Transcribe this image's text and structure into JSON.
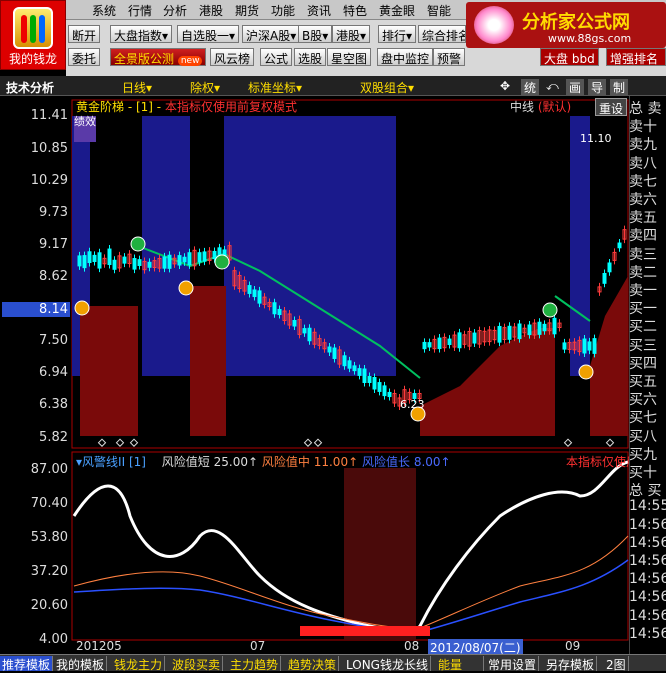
{
  "menu": [
    "系统",
    "行情",
    "分析",
    "港股",
    "期货",
    "功能",
    "资讯",
    "特色",
    "黄金眼",
    "智能"
  ],
  "logo_label": "我的钱龙",
  "toolbar_row1": [
    "断开",
    "大盘指数",
    "自选股一",
    "沪深A股",
    "B股",
    "港股",
    "排行",
    "综合排名"
  ],
  "toolbar_row2": [
    "委托",
    "全景版公测",
    "风云榜",
    "公式",
    "选股",
    "星空图",
    "盘中监控",
    "预警"
  ],
  "toolbar_row2_badge": "new",
  "watermark": {
    "title": "分析家公式网",
    "url": "www.88gs.com"
  },
  "right_tabs": [
    "大盘",
    "bbd",
    "增强排名"
  ],
  "bar2": {
    "section": "技术分析",
    "period": "日线",
    "adjust": "除权",
    "coord": "标准坐标",
    "dual": "双股组合",
    "icons": [
      "统",
      "画",
      "导",
      "制"
    ]
  },
  "main_panel": {
    "title": "黄金阶梯",
    "param": "[1]",
    "note": "本指标仅使用前复权模式",
    "mid_label": "中线",
    "default_label": "(默认)",
    "reset": "重设",
    "perf_badge": "绩效",
    "y_ticks": [
      "11.41",
      "10.85",
      "10.29",
      "9.73",
      "9.17",
      "8.62",
      "8.14",
      "7.50",
      "6.94",
      "6.38",
      "5.82"
    ],
    "current_price": "8.14",
    "high_label": "11.10",
    "low_label": "6.23"
  },
  "sub_panel": {
    "title": "风警线II",
    "param": "[1]",
    "risk_short_label": "风险值短",
    "risk_short": "25.00",
    "risk_mid_label": "风险值中",
    "risk_mid": "11.00",
    "risk_long_label": "风险值长",
    "risk_long": "8.00",
    "note": "本指标仅使用前复",
    "y_ticks": [
      "87.00",
      "70.40",
      "53.80",
      "37.20",
      "20.60",
      "4.00"
    ]
  },
  "x_axis": [
    "201205",
    "07",
    "08",
    "09"
  ],
  "cursor_date": "2012/08/07(二)",
  "right_list": [
    "总 卖",
    "卖十",
    "卖九",
    "卖八",
    "卖七",
    "卖六",
    "卖五",
    "卖四",
    "卖三",
    "卖二",
    "卖一",
    "买一",
    "买二",
    "买三",
    "买四",
    "买五",
    "买六",
    "买七",
    "买八",
    "买九",
    "买十",
    "总 买",
    "14:55",
    "14:56",
    "14:56",
    "14:56",
    "14:56",
    "14:56",
    "14:56",
    "14:56"
  ],
  "bottom_tabs": [
    "推荐模板",
    "我的模板",
    "钱龙主力",
    "波段买卖",
    "主力趋势",
    "趋势决策",
    "LONG钱龙长线",
    "能量",
    "常用设置",
    "另存模板",
    "2图"
  ],
  "colors": {
    "up": "#ff3c3c",
    "down": "#00ffff",
    "blue_zone": "#1a1a8c",
    "red_zone": "#7a0a0a",
    "green_stair": "#00c060"
  }
}
